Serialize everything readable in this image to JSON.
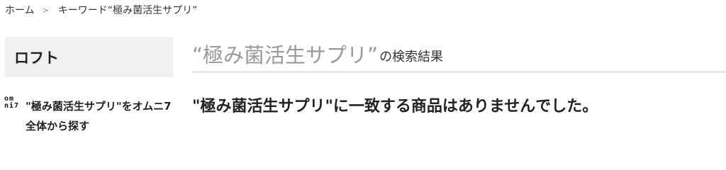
{
  "breadcrumb": {
    "home_label": "ホーム",
    "separator_icon": "chevron-right-icon",
    "current_label": "キーワード“極み菌活生サプリ”"
  },
  "sidebar": {
    "title": "ロフト",
    "omni_link": {
      "logo_lines": [
        "om",
        "ni7"
      ],
      "text": "\"極み菌活生サプリ\"をオムニ7全体から探す"
    }
  },
  "main": {
    "keyword_heading": "“極み菌活生サプリ”",
    "heading_suffix": "の検索結果",
    "no_result_message": "\"極み菌活生サプリ\"に一致する商品はありませんでした。"
  }
}
